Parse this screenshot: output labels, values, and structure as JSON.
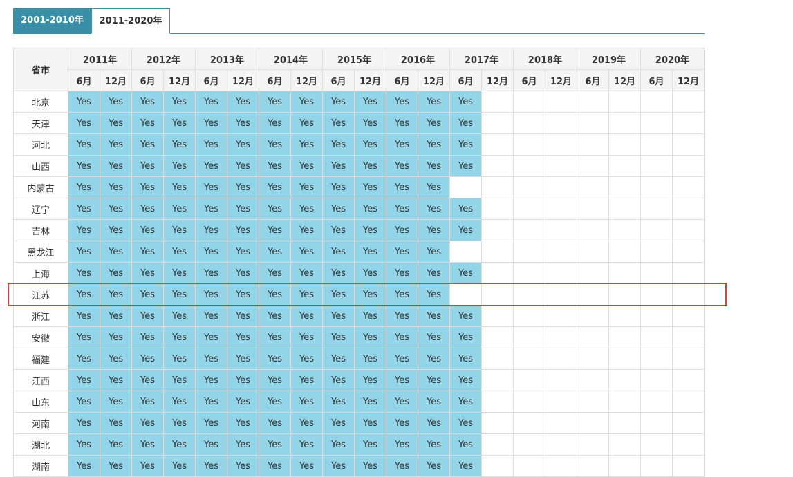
{
  "tabs": [
    {
      "label": "2001-2010年",
      "active": true
    },
    {
      "label": "2011-2020年",
      "active": false
    }
  ],
  "table": {
    "province_header": "省市",
    "years": [
      "2011年",
      "2012年",
      "2013年",
      "2014年",
      "2015年",
      "2016年",
      "2017年",
      "2018年",
      "2019年",
      "2020年"
    ],
    "months": [
      "6月",
      "12月"
    ],
    "yes_label": "Yes",
    "highlighted_row": "江苏",
    "rows": [
      {
        "province": "北京",
        "filled": 13
      },
      {
        "province": "天津",
        "filled": 13
      },
      {
        "province": "河北",
        "filled": 13
      },
      {
        "province": "山西",
        "filled": 13
      },
      {
        "province": "内蒙古",
        "filled": 12
      },
      {
        "province": "辽宁",
        "filled": 13
      },
      {
        "province": "吉林",
        "filled": 13
      },
      {
        "province": "黑龙江",
        "filled": 12
      },
      {
        "province": "上海",
        "filled": 13
      },
      {
        "province": "江苏",
        "filled": 12
      },
      {
        "province": "浙江",
        "filled": 13
      },
      {
        "province": "安徽",
        "filled": 13
      },
      {
        "province": "福建",
        "filled": 13
      },
      {
        "province": "江西",
        "filled": 13
      },
      {
        "province": "山东",
        "filled": 13
      },
      {
        "province": "河南",
        "filled": 13
      },
      {
        "province": "湖北",
        "filled": 13
      },
      {
        "province": "湖南",
        "filled": 13
      }
    ]
  },
  "colors": {
    "accent": "#3a8ea5",
    "yes_cell": "#92d4e8",
    "highlight_border": "#e53935",
    "header_bg": "#f4f4f4"
  }
}
